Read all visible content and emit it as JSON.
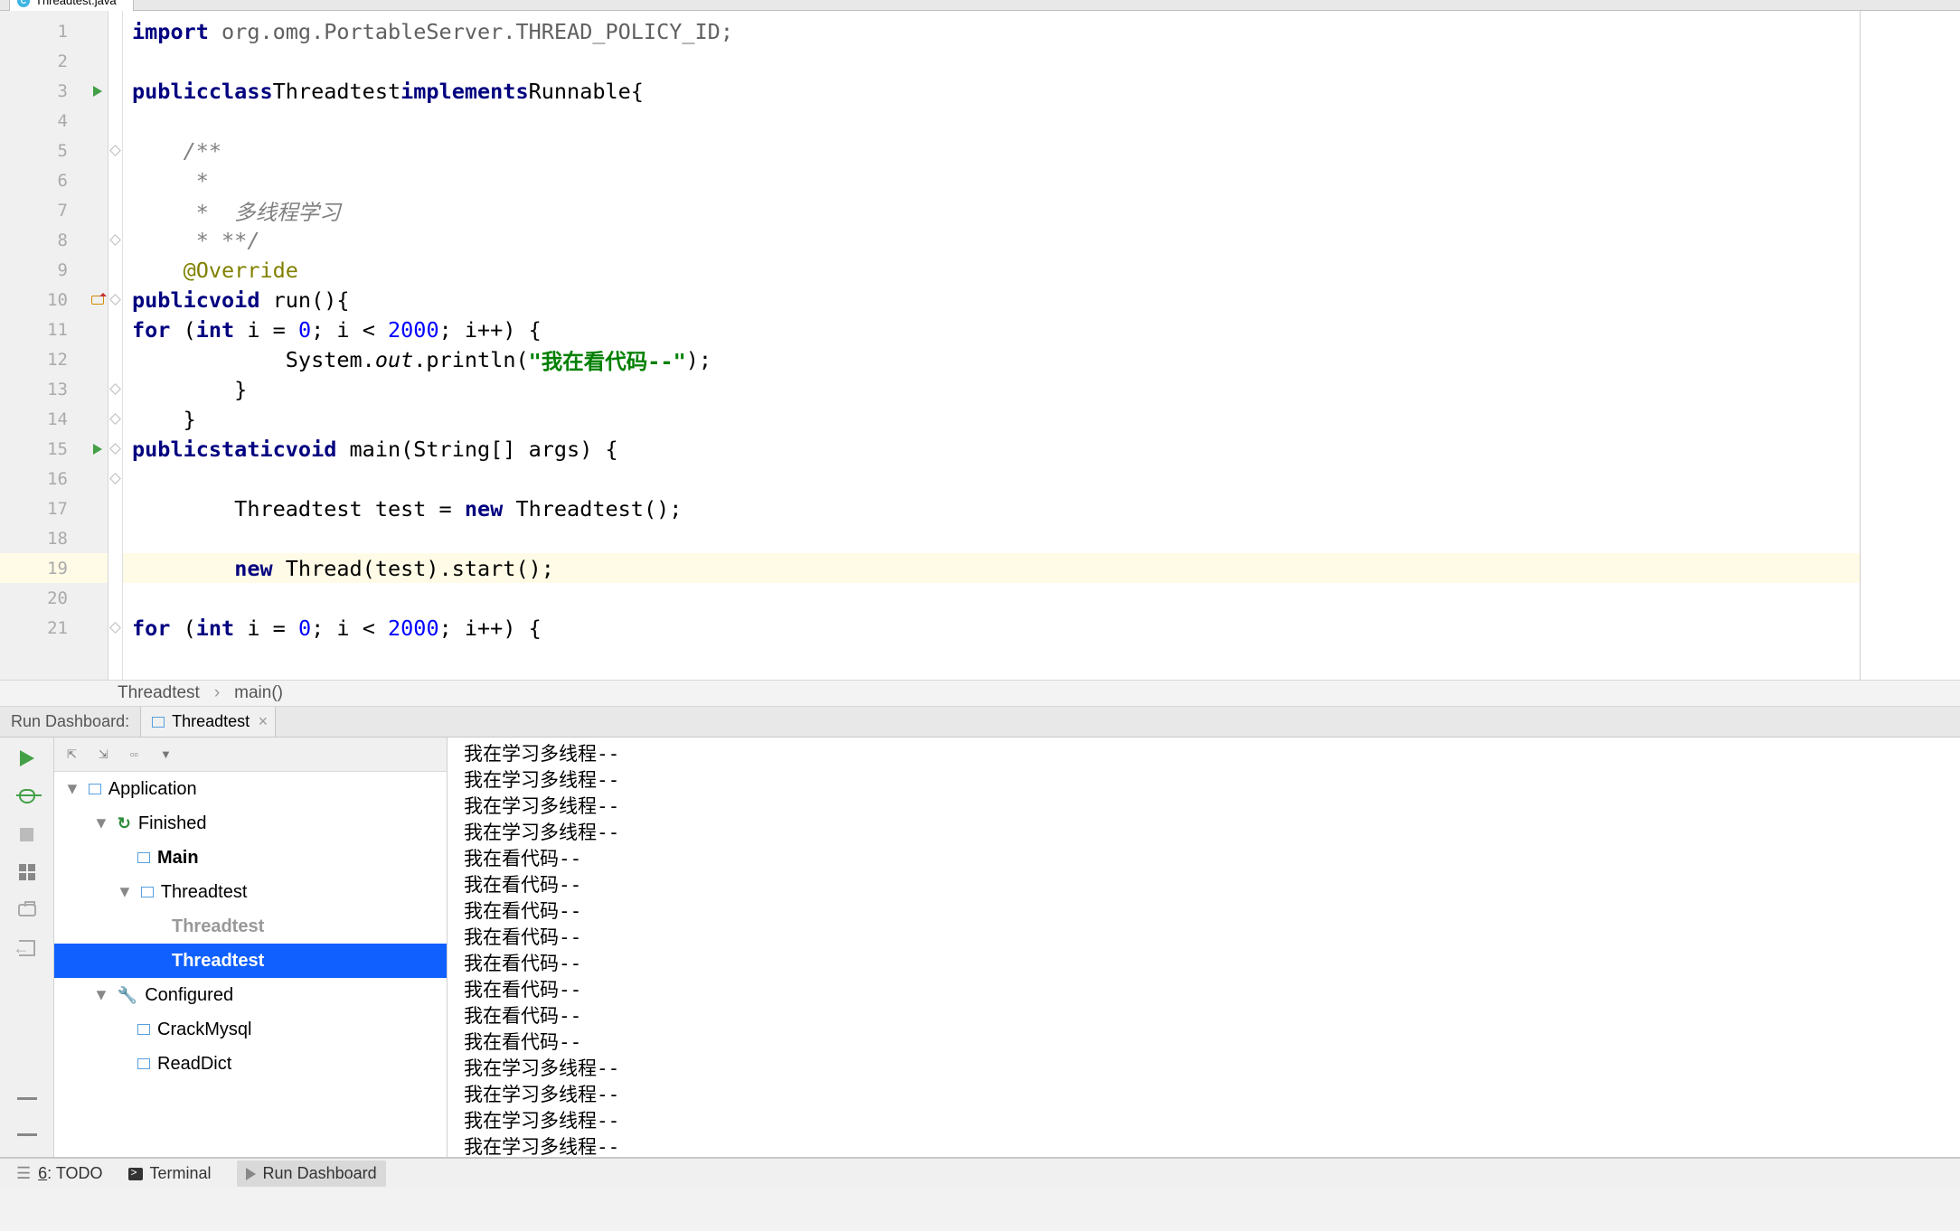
{
  "tab": {
    "filename": "Threadtest.java"
  },
  "editor": {
    "lines": [
      {
        "n": 1
      },
      {
        "n": 2
      },
      {
        "n": 3,
        "run": true
      },
      {
        "n": 4
      },
      {
        "n": 5
      },
      {
        "n": 6
      },
      {
        "n": 7
      },
      {
        "n": 8
      },
      {
        "n": 9
      },
      {
        "n": 10,
        "ov": true
      },
      {
        "n": 11
      },
      {
        "n": 12
      },
      {
        "n": 13
      },
      {
        "n": 14
      },
      {
        "n": 15,
        "run": true
      },
      {
        "n": 16
      },
      {
        "n": 17
      },
      {
        "n": 18
      },
      {
        "n": 19,
        "hl": true
      },
      {
        "n": 20
      },
      {
        "n": 21
      }
    ],
    "code": {
      "l1_kw": "import",
      "l1_pkg": " org.omg.PortableServer.THREAD_POLICY_ID;",
      "l3_p": "public",
      "l3_c": "class",
      "l3_cls": "Threadtest",
      "l3_imp": "implements",
      "l3_ifc": "Runnable",
      "l3_b": "{",
      "l5": "    /**",
      "l6": "     *",
      "l7": "     *  多线程学习",
      "l8": "     * **/",
      "l9_ann": "    @Override",
      "l10_p": "public",
      "l10_v": "void",
      "l10_m": " run(){",
      "l11_for": "for",
      "l11_int": "int",
      "l11_pre": " (",
      "l11_var": " i = ",
      "l11_zero": "0",
      "l11_mid": "; i < ",
      "l11_lim": "2000",
      "l11_post": "; i++) {",
      "l12_pre": "            System.",
      "l12_out": "out",
      "l12_mid": ".println(",
      "l12_str": "\"我在看代码--\"",
      "l12_post": ");",
      "l13": "        }",
      "l14": "    }",
      "l15_p": "public",
      "l15_s": "static",
      "l15_v": "void",
      "l15_m": " main(String[] args) {",
      "l17_pre": "        Threadtest test = ",
      "l17_new": "new",
      "l17_post": " Threadtest();",
      "l19_pre": "        ",
      "l19_new": "new",
      "l19_post": " Thread(test).start();",
      "l21_for": "for",
      "l21_int": "int",
      "l21_pre": " (",
      "l21_var": " i = ",
      "l21_zero": "0",
      "l21_mid": "; i < ",
      "l21_lim": "2000",
      "l21_post": "; i++) {"
    }
  },
  "breadcrumb": {
    "a": "Threadtest",
    "b": "main()"
  },
  "rd_header": {
    "title": "Run Dashboard:",
    "tab": "Threadtest"
  },
  "tree": {
    "app": "Application",
    "finished": "Finished",
    "main": "Main",
    "tt1": "Threadtest",
    "tt2": "Threadtest",
    "tt3": "Threadtest",
    "conf": "Configured",
    "cm": "CrackMysql",
    "rd": "ReadDict"
  },
  "console_lines": [
    "我在学习多线程--",
    "我在学习多线程--",
    "我在学习多线程--",
    "我在学习多线程--",
    "我在看代码--",
    "我在看代码--",
    "我在看代码--",
    "我在看代码--",
    "我在看代码--",
    "我在看代码--",
    "我在看代码--",
    "我在看代码--",
    "我在学习多线程--",
    "我在学习多线程--",
    "我在学习多线程--",
    "我在学习多线程--"
  ],
  "bottom": {
    "todo_u": "6",
    "todo": ": TODO",
    "terminal": "Terminal",
    "rd": "Run Dashboard"
  }
}
